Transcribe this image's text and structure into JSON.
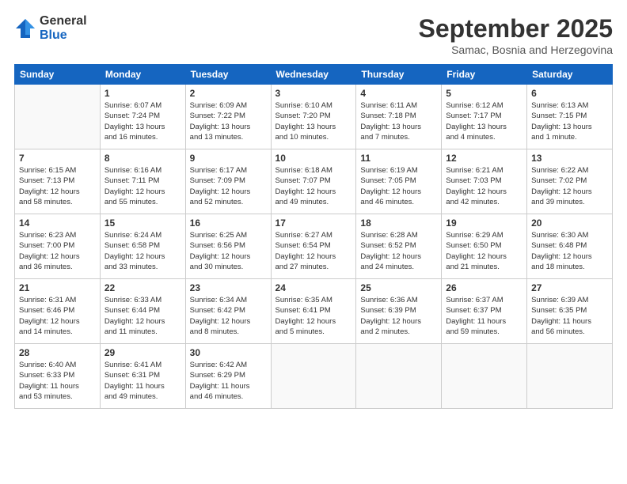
{
  "logo": {
    "general": "General",
    "blue": "Blue"
  },
  "title": "September 2025",
  "location": "Samac, Bosnia and Herzegovina",
  "days_header": [
    "Sunday",
    "Monday",
    "Tuesday",
    "Wednesday",
    "Thursday",
    "Friday",
    "Saturday"
  ],
  "weeks": [
    [
      {
        "day": "",
        "info": ""
      },
      {
        "day": "1",
        "info": "Sunrise: 6:07 AM\nSunset: 7:24 PM\nDaylight: 13 hours\nand 16 minutes."
      },
      {
        "day": "2",
        "info": "Sunrise: 6:09 AM\nSunset: 7:22 PM\nDaylight: 13 hours\nand 13 minutes."
      },
      {
        "day": "3",
        "info": "Sunrise: 6:10 AM\nSunset: 7:20 PM\nDaylight: 13 hours\nand 10 minutes."
      },
      {
        "day": "4",
        "info": "Sunrise: 6:11 AM\nSunset: 7:18 PM\nDaylight: 13 hours\nand 7 minutes."
      },
      {
        "day": "5",
        "info": "Sunrise: 6:12 AM\nSunset: 7:17 PM\nDaylight: 13 hours\nand 4 minutes."
      },
      {
        "day": "6",
        "info": "Sunrise: 6:13 AM\nSunset: 7:15 PM\nDaylight: 13 hours\nand 1 minute."
      }
    ],
    [
      {
        "day": "7",
        "info": "Sunrise: 6:15 AM\nSunset: 7:13 PM\nDaylight: 12 hours\nand 58 minutes."
      },
      {
        "day": "8",
        "info": "Sunrise: 6:16 AM\nSunset: 7:11 PM\nDaylight: 12 hours\nand 55 minutes."
      },
      {
        "day": "9",
        "info": "Sunrise: 6:17 AM\nSunset: 7:09 PM\nDaylight: 12 hours\nand 52 minutes."
      },
      {
        "day": "10",
        "info": "Sunrise: 6:18 AM\nSunset: 7:07 PM\nDaylight: 12 hours\nand 49 minutes."
      },
      {
        "day": "11",
        "info": "Sunrise: 6:19 AM\nSunset: 7:05 PM\nDaylight: 12 hours\nand 46 minutes."
      },
      {
        "day": "12",
        "info": "Sunrise: 6:21 AM\nSunset: 7:03 PM\nDaylight: 12 hours\nand 42 minutes."
      },
      {
        "day": "13",
        "info": "Sunrise: 6:22 AM\nSunset: 7:02 PM\nDaylight: 12 hours\nand 39 minutes."
      }
    ],
    [
      {
        "day": "14",
        "info": "Sunrise: 6:23 AM\nSunset: 7:00 PM\nDaylight: 12 hours\nand 36 minutes."
      },
      {
        "day": "15",
        "info": "Sunrise: 6:24 AM\nSunset: 6:58 PM\nDaylight: 12 hours\nand 33 minutes."
      },
      {
        "day": "16",
        "info": "Sunrise: 6:25 AM\nSunset: 6:56 PM\nDaylight: 12 hours\nand 30 minutes."
      },
      {
        "day": "17",
        "info": "Sunrise: 6:27 AM\nSunset: 6:54 PM\nDaylight: 12 hours\nand 27 minutes."
      },
      {
        "day": "18",
        "info": "Sunrise: 6:28 AM\nSunset: 6:52 PM\nDaylight: 12 hours\nand 24 minutes."
      },
      {
        "day": "19",
        "info": "Sunrise: 6:29 AM\nSunset: 6:50 PM\nDaylight: 12 hours\nand 21 minutes."
      },
      {
        "day": "20",
        "info": "Sunrise: 6:30 AM\nSunset: 6:48 PM\nDaylight: 12 hours\nand 18 minutes."
      }
    ],
    [
      {
        "day": "21",
        "info": "Sunrise: 6:31 AM\nSunset: 6:46 PM\nDaylight: 12 hours\nand 14 minutes."
      },
      {
        "day": "22",
        "info": "Sunrise: 6:33 AM\nSunset: 6:44 PM\nDaylight: 12 hours\nand 11 minutes."
      },
      {
        "day": "23",
        "info": "Sunrise: 6:34 AM\nSunset: 6:42 PM\nDaylight: 12 hours\nand 8 minutes."
      },
      {
        "day": "24",
        "info": "Sunrise: 6:35 AM\nSunset: 6:41 PM\nDaylight: 12 hours\nand 5 minutes."
      },
      {
        "day": "25",
        "info": "Sunrise: 6:36 AM\nSunset: 6:39 PM\nDaylight: 12 hours\nand 2 minutes."
      },
      {
        "day": "26",
        "info": "Sunrise: 6:37 AM\nSunset: 6:37 PM\nDaylight: 11 hours\nand 59 minutes."
      },
      {
        "day": "27",
        "info": "Sunrise: 6:39 AM\nSunset: 6:35 PM\nDaylight: 11 hours\nand 56 minutes."
      }
    ],
    [
      {
        "day": "28",
        "info": "Sunrise: 6:40 AM\nSunset: 6:33 PM\nDaylight: 11 hours\nand 53 minutes."
      },
      {
        "day": "29",
        "info": "Sunrise: 6:41 AM\nSunset: 6:31 PM\nDaylight: 11 hours\nand 49 minutes."
      },
      {
        "day": "30",
        "info": "Sunrise: 6:42 AM\nSunset: 6:29 PM\nDaylight: 11 hours\nand 46 minutes."
      },
      {
        "day": "",
        "info": ""
      },
      {
        "day": "",
        "info": ""
      },
      {
        "day": "",
        "info": ""
      },
      {
        "day": "",
        "info": ""
      }
    ]
  ]
}
